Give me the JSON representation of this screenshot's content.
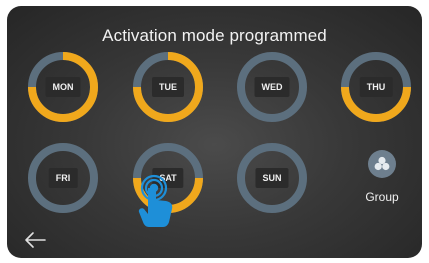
{
  "header": {
    "title": "Activation mode programmed"
  },
  "colors": {
    "active": "#f0a81c",
    "inactive": "#5c6f7e",
    "label_bg": "#2b2b2b",
    "touch": "#1e8fd8"
  },
  "days": [
    {
      "label": "MON",
      "active_fraction": 0.75,
      "start_fraction": 0.0
    },
    {
      "label": "TUE",
      "active_fraction": 0.75,
      "start_fraction": 0.0
    },
    {
      "label": "WED",
      "active_fraction": 0.0,
      "start_fraction": 0.0
    },
    {
      "label": "THU",
      "active_fraction": 0.5,
      "start_fraction": 0.25
    },
    {
      "label": "FRI",
      "active_fraction": 0.0,
      "start_fraction": 0.0
    },
    {
      "label": "SAT",
      "active_fraction": 0.5,
      "start_fraction": 0.25
    },
    {
      "label": "SUN",
      "active_fraction": 0.0,
      "start_fraction": 0.0
    }
  ],
  "group": {
    "label": "Group",
    "icon": "group-icon"
  },
  "nav": {
    "back_icon": "back-arrow-icon"
  }
}
